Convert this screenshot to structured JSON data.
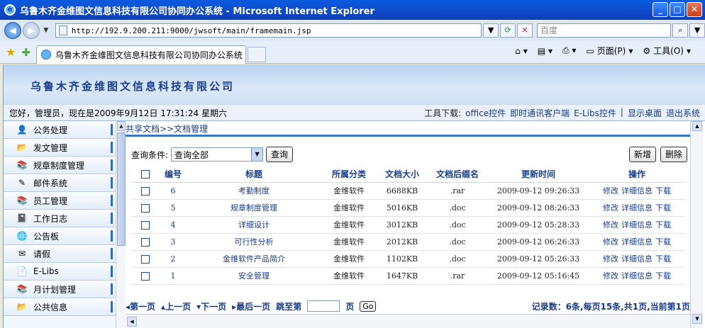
{
  "window": {
    "title": "乌鲁木齐金维图文信息科技有限公司协同办公系统 - Microsoft Internet Explorer",
    "url": "http://192.9.200.211:9000/jwsoft/main/framemain.jsp",
    "search_placeholder": "百度",
    "tab_label": "乌鲁木齐金维图文信息科技有限公司协同办公系统",
    "cmd_page": "页面(P)",
    "cmd_tools": "工具(O)"
  },
  "banner": {
    "company": "乌鲁木齐金维图文信息科技有限公司"
  },
  "status": {
    "greeting": "您好，管理员，现在是2009年9月12日  17:31:24 星期六",
    "tools_label": "工具下载:",
    "links": [
      "office控件",
      "即时通讯客户端",
      "E-Libs控件",
      "|",
      "显示桌面",
      "退出系统"
    ]
  },
  "sidebar": {
    "items": [
      {
        "label": "公务处理",
        "icon": "person-icon",
        "glyph": "👤"
      },
      {
        "label": "发文管理",
        "icon": "folder-icon",
        "glyph": "📂"
      },
      {
        "label": "规章制度管理",
        "icon": "books-icon",
        "glyph": "📚"
      },
      {
        "label": "邮件系统",
        "icon": "pencil-icon",
        "glyph": "✎"
      },
      {
        "label": "员工管理",
        "icon": "books-icon",
        "glyph": "📚"
      },
      {
        "label": "工作日志",
        "icon": "notebook-icon",
        "glyph": "📓"
      },
      {
        "label": "公告板",
        "icon": "globe-icon",
        "glyph": "🌐"
      },
      {
        "label": "请假",
        "icon": "envelope-icon",
        "glyph": "✉"
      },
      {
        "label": "E-Libs",
        "icon": "document-icon",
        "glyph": "📄"
      },
      {
        "label": "月计划管理",
        "icon": "books-icon",
        "glyph": "📚"
      },
      {
        "label": "公共信息",
        "icon": "folder-icon",
        "glyph": "📂"
      }
    ]
  },
  "main": {
    "breadcrumb": "共享文档>>文档管理",
    "query_label": "查询条件:",
    "query_value": "查询全部",
    "query_button": "查询",
    "add_button": "新增",
    "delete_button": "删除",
    "headers": [
      "",
      "编号",
      "标题",
      "所属分类",
      "文档大小",
      "文档后缀名",
      "更新时间",
      "操作"
    ],
    "rows": [
      {
        "id": "6",
        "title": "考勤制度",
        "category": "金维软件",
        "size": "6688KB",
        "ext": ".rar",
        "time": "2009-09-12 09:26:33"
      },
      {
        "id": "5",
        "title": "规章制度管理",
        "category": "金维软件",
        "size": "5016KB",
        "ext": ".doc",
        "time": "2009-09-12 08:26:33"
      },
      {
        "id": "4",
        "title": "详细设计",
        "category": "金维软件",
        "size": "3012KB",
        "ext": ".doc",
        "time": "2009-09-12 05:28:33"
      },
      {
        "id": "3",
        "title": "可行性分析",
        "category": "金维软件",
        "size": "2012KB",
        "ext": ".doc",
        "time": "2009-09-12 06:26:33"
      },
      {
        "id": "2",
        "title": "金维软件产品简介",
        "category": "金维软件",
        "size": "1102KB",
        "ext": ".doc",
        "time": "2009-09-12 05:26:33"
      },
      {
        "id": "1",
        "title": "安全管理",
        "category": "金维软件",
        "size": "1647KB",
        "ext": ".rar",
        "time": "2009-09-12 05:16:45"
      }
    ],
    "ops": [
      "修改",
      "详细信息",
      "下载"
    ],
    "pager": {
      "first": "第一页",
      "prev": "上一页",
      "next": "下一页",
      "last": "最后一页",
      "jump": "跳至第",
      "page_suffix": "页",
      "go": "Go",
      "summary": "记录数：6条,每页15条,共1页,当前第1页"
    }
  }
}
